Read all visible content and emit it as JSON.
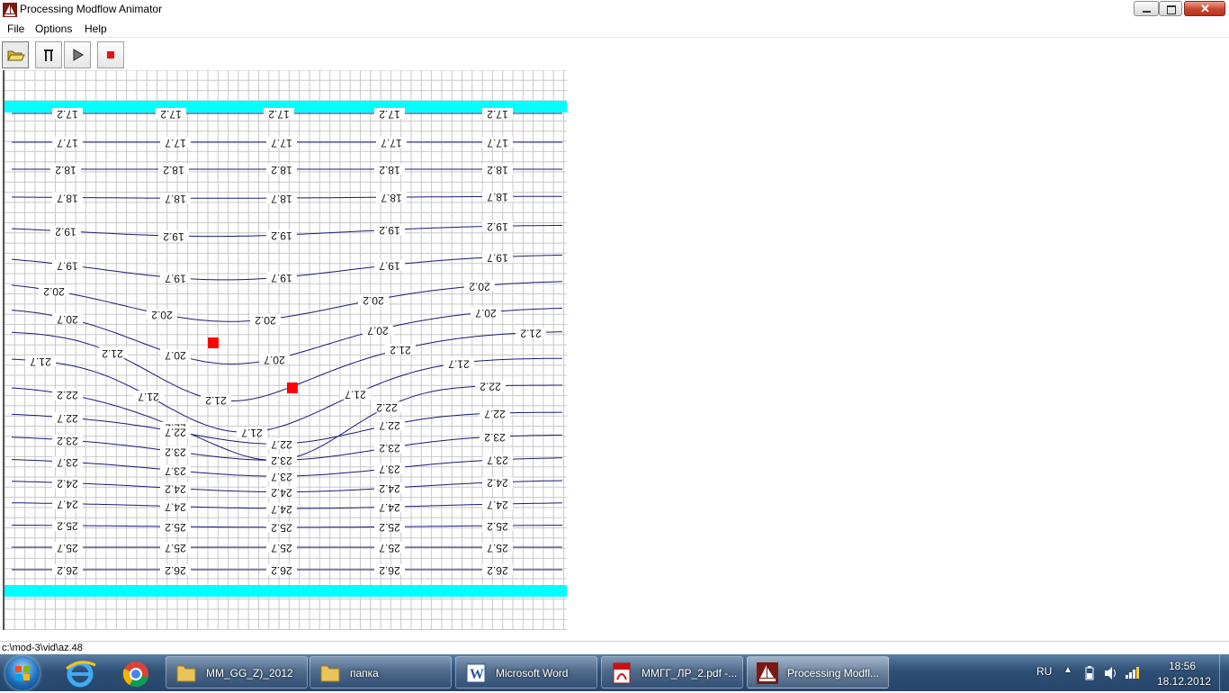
{
  "window": {
    "title": "Processing Modflow Animator"
  },
  "menu": [
    "File",
    "Options",
    "Help"
  ],
  "toolbar": {
    "open": "open-folder-icon",
    "pause": "pause-icon",
    "play": "play-icon",
    "stop": "stop-icon"
  },
  "colors": {
    "boundary": "#00ffff",
    "contour": "#1a1a7a",
    "well": "#ff0000",
    "grid": "#c8c8c8",
    "taskbar": "#2f4f75"
  },
  "contours": [
    {
      "label": "17.2",
      "labels_at": [
        70,
        185,
        305,
        428,
        548
      ]
    },
    {
      "label": "17.7",
      "labels_at": [
        70,
        190,
        308,
        430,
        548
      ]
    },
    {
      "label": "18.2",
      "labels_at": [
        68,
        188,
        308,
        428,
        548
      ]
    },
    {
      "label": "18.7",
      "labels_at": [
        70,
        190,
        308,
        430,
        548
      ]
    },
    {
      "label": "19.2",
      "labels_at": [
        68,
        188,
        308,
        428,
        548
      ]
    },
    {
      "label": "19.7",
      "labels_at": [
        70,
        190,
        308,
        428,
        548
      ]
    },
    {
      "label": "20.2",
      "labels_at": [
        55,
        175,
        290,
        410,
        528
      ]
    },
    {
      "label": "20.7",
      "labels_at": [
        70,
        190,
        300,
        415,
        535
      ]
    },
    {
      "label": "21.2",
      "labels_at": [
        120,
        235,
        440,
        585
      ]
    },
    {
      "label": "21.7",
      "labels_at": [
        40,
        160,
        275,
        390,
        505
      ]
    },
    {
      "label": "22.2",
      "labels_at": [
        70,
        190,
        308,
        425,
        540
      ]
    },
    {
      "label": "22.7",
      "labels_at": [
        70,
        190,
        308,
        428,
        545
      ]
    },
    {
      "label": "23.2",
      "labels_at": [
        70,
        190,
        308,
        428,
        545
      ]
    },
    {
      "label": "23.7",
      "labels_at": [
        70,
        190,
        308,
        428,
        548
      ]
    },
    {
      "label": "24.2",
      "labels_at": [
        70,
        190,
        308,
        428,
        548
      ]
    },
    {
      "label": "24.7",
      "labels_at": [
        70,
        190,
        308,
        428,
        548
      ]
    },
    {
      "label": "25.2",
      "labels_at": [
        70,
        190,
        308,
        428,
        548
      ]
    },
    {
      "label": "25.7",
      "labels_at": [
        70,
        190,
        308,
        428,
        548
      ]
    },
    {
      "label": "26.2",
      "labels_at": [
        70,
        190,
        308,
        428,
        548
      ]
    }
  ],
  "wells": [
    {
      "col": "A"
    },
    {
      "col": "B"
    }
  ],
  "status": {
    "path": "c:\\mod-3\\vid\\az.48"
  },
  "taskbar": {
    "items": [
      {
        "label": "MM_GG_Z)_2012",
        "icon": "folder-icon"
      },
      {
        "label": "папка",
        "icon": "folder-icon"
      },
      {
        "label": "Microsoft Word",
        "icon": "word-icon"
      },
      {
        "label": "ММГГ_ЛР_2.pdf -...",
        "icon": "pdf-icon"
      },
      {
        "label": "Processing Modfl...",
        "icon": "modflow-icon"
      }
    ],
    "lang": "RU",
    "time": "18:56",
    "date": "18.12.2012"
  }
}
